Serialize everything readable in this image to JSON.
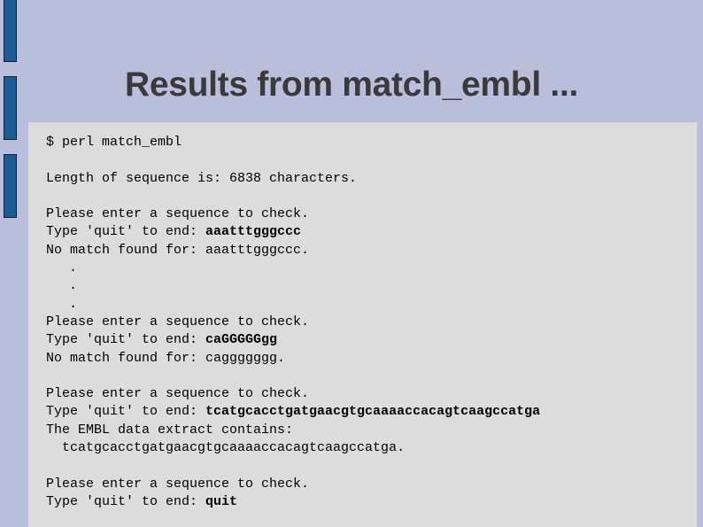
{
  "slide": {
    "title": "Results from match_embl ...",
    "background_color": "#b9bedb",
    "title_color": "#3a3a3a",
    "panel_color": "#dcdcdc",
    "accent_bar_color": "#1a5e96"
  },
  "decor": {
    "bars": [
      {
        "name": "left-accent-bar-1"
      },
      {
        "name": "left-accent-bar-2"
      },
      {
        "name": "left-accent-bar-3"
      }
    ]
  },
  "terminal": {
    "lines": [
      {
        "id": "cmd",
        "text": "$ perl match_embl"
      },
      {
        "id": "blank1",
        "text": ""
      },
      {
        "id": "length",
        "text": "Length of sequence is: 6838 characters."
      },
      {
        "id": "blank2",
        "text": ""
      },
      {
        "id": "prompt1a",
        "text": "Please enter a sequence to check."
      },
      {
        "id": "prompt1b",
        "text": "Type 'quit' to end: ",
        "input": "aaatttgggccc"
      },
      {
        "id": "result1",
        "text": "No match found for: aaatttgggccc."
      },
      {
        "id": "dot1",
        "text": ".",
        "indent": true
      },
      {
        "id": "dot2",
        "text": ".",
        "indent": true
      },
      {
        "id": "dot3",
        "text": ".",
        "indent": true
      },
      {
        "id": "prompt2a",
        "text": "Please enter a sequence to check."
      },
      {
        "id": "prompt2b",
        "text": "Type 'quit' to end: ",
        "input": "caGGGGGgg"
      },
      {
        "id": "result2",
        "text": "No match found for: caggggggg."
      },
      {
        "id": "blank3",
        "text": ""
      },
      {
        "id": "prompt3a",
        "text": "Please enter a sequence to check."
      },
      {
        "id": "prompt3b",
        "text": "Type 'quit' to end: ",
        "input": "tcatgcacctgatgaacgtgcaaaaccacagtcaagccatga"
      },
      {
        "id": "result3a",
        "text": "The EMBL data extract contains:"
      },
      {
        "id": "result3b",
        "text": "  tcatgcacctgatgaacgtgcaaaaccacagtcaagccatga."
      },
      {
        "id": "blank4",
        "text": ""
      },
      {
        "id": "prompt4a",
        "text": "Please enter a sequence to check."
      },
      {
        "id": "prompt4b",
        "text": "Type 'quit' to end: ",
        "input": "quit"
      }
    ]
  }
}
